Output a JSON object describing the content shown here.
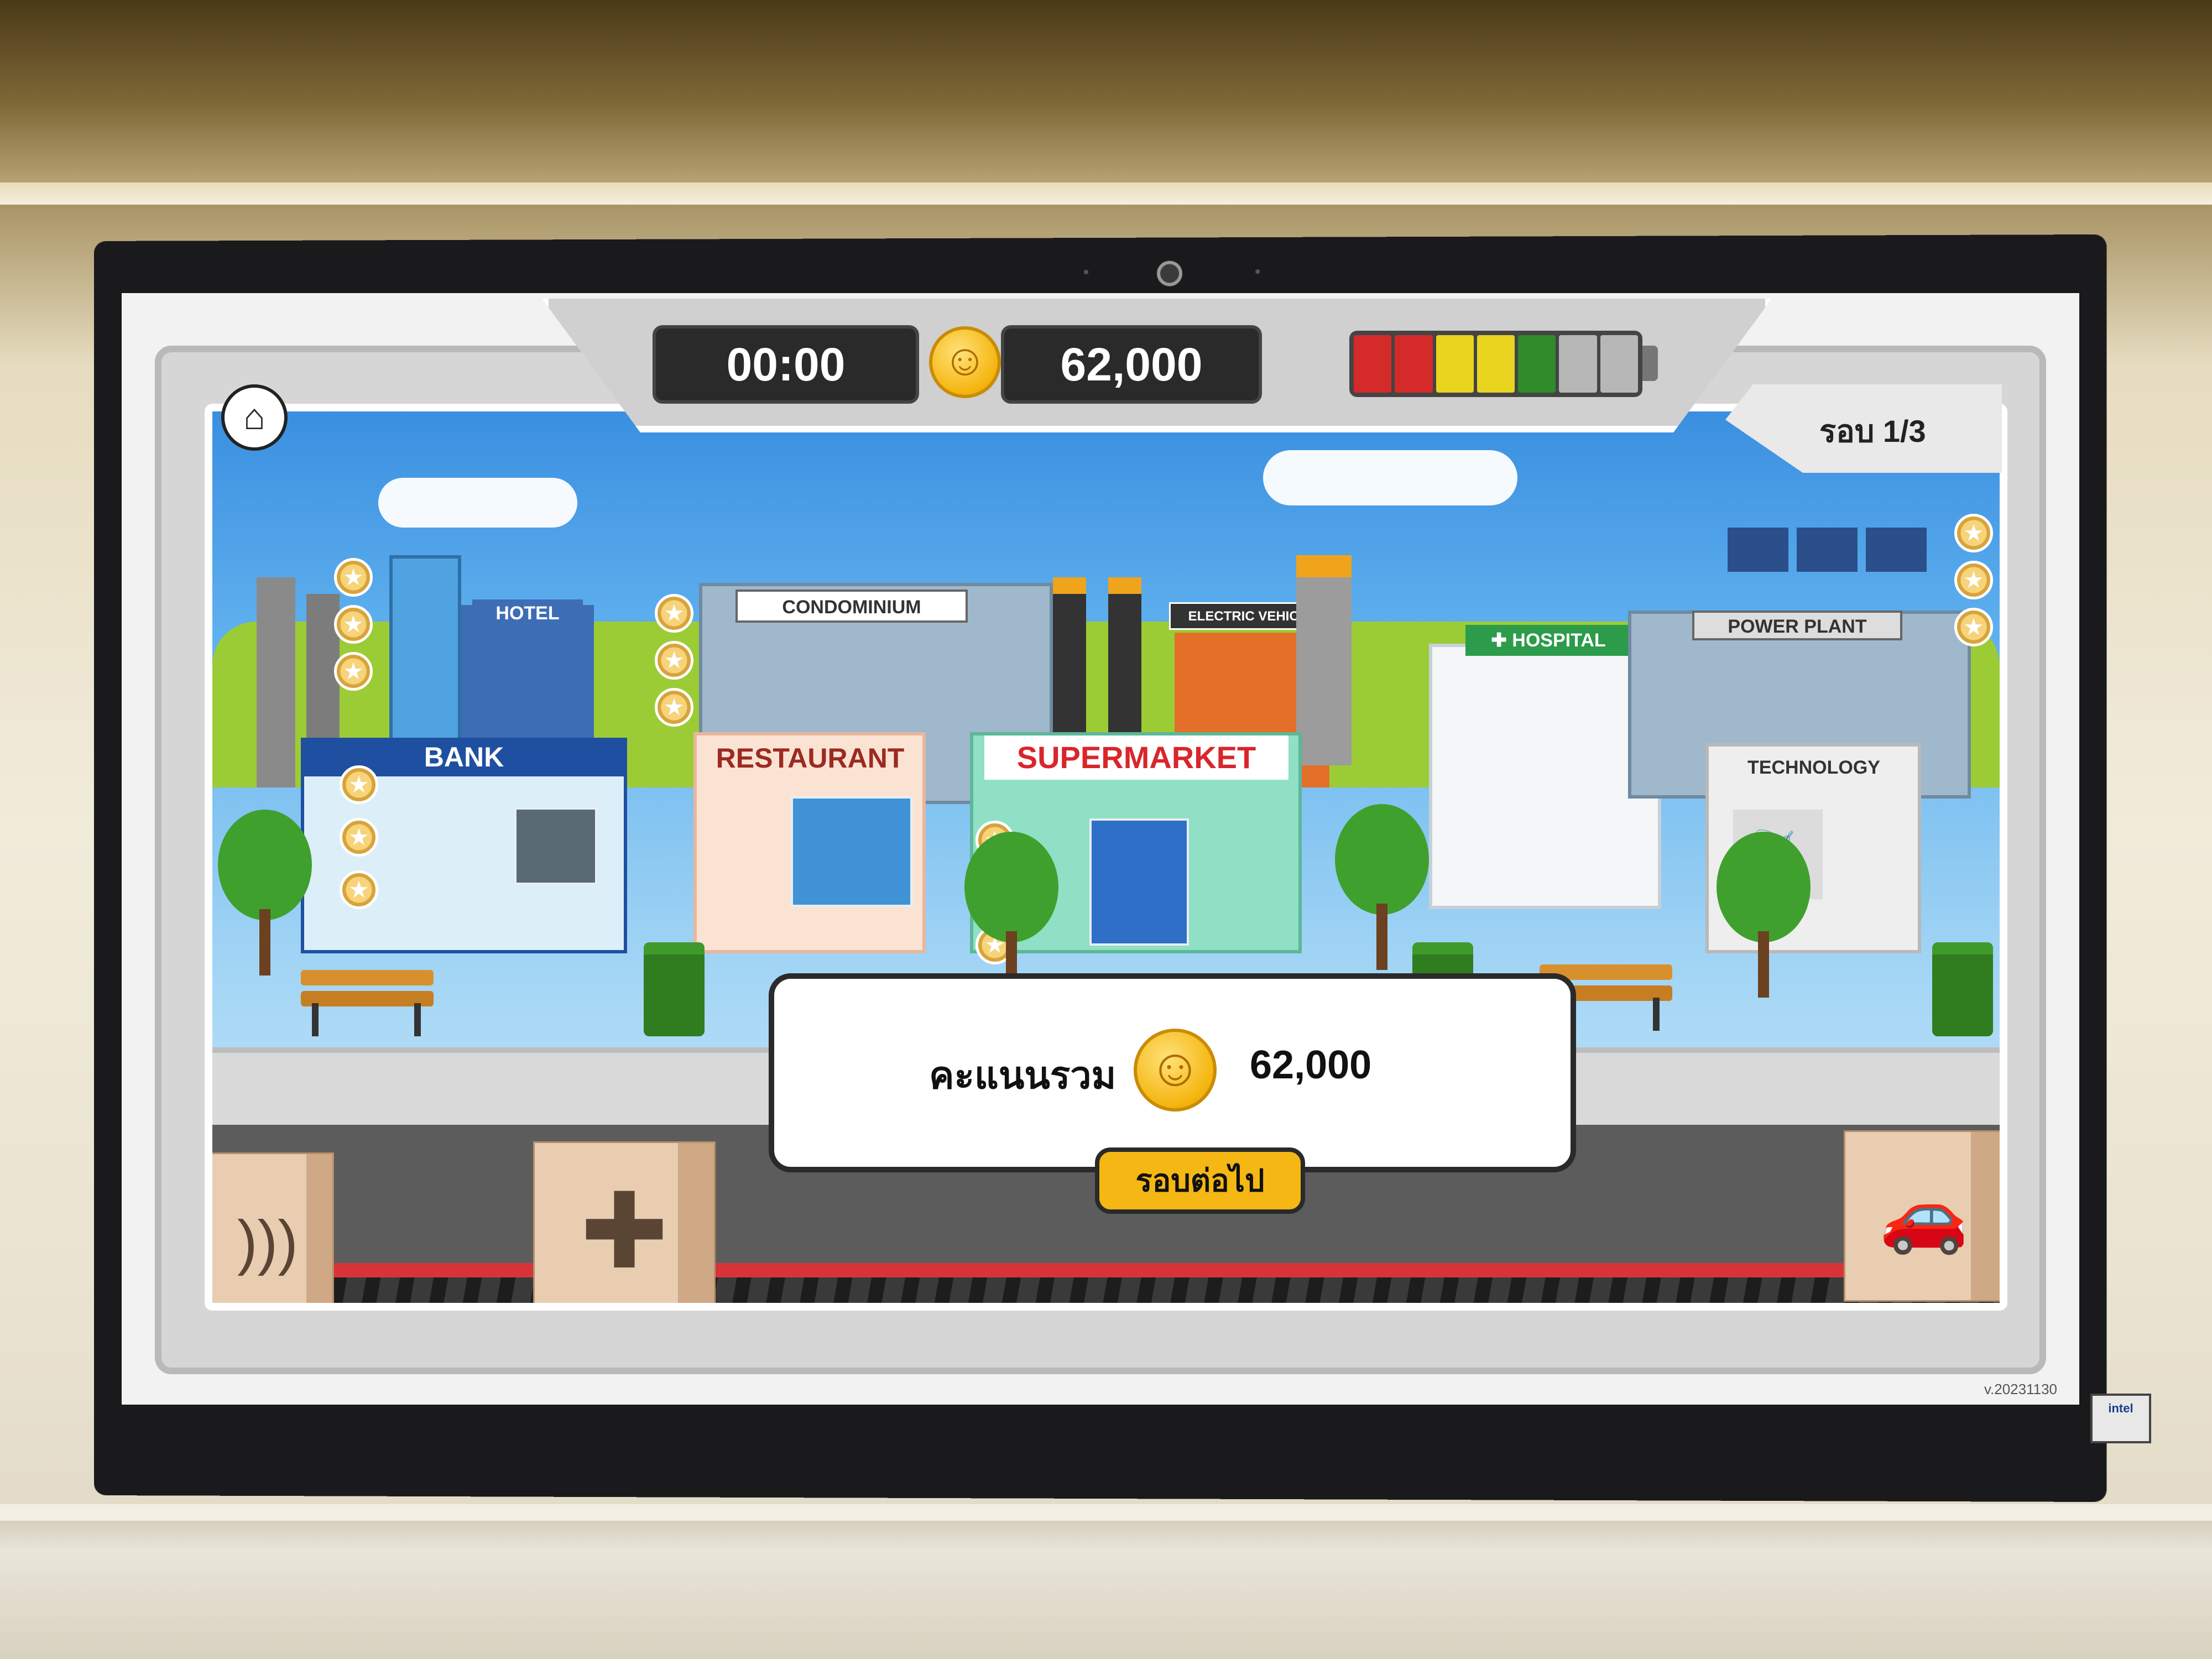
{
  "hud": {
    "timer": "00:00",
    "score": "62,000",
    "battery_cells": [
      "#d42a2a",
      "#d42a2a",
      "#e9d420",
      "#e9d420",
      "#2f8a2a",
      "#b7b7b7",
      "#b7b7b7"
    ],
    "round": "รอบ 1/3"
  },
  "scene": {
    "buildings": {
      "hotel": "HOTEL",
      "condominium": "CONDOMINIUM",
      "electric_vehicle": "ELECTRIC VEHICLE",
      "hospital": "HOSPITAL",
      "power_plant": "POWER PLANT",
      "bank": "BANK",
      "restaurant": "RESTAURANT",
      "supermarket": "SUPERMARKET",
      "technology": "TECHNOLOGY"
    }
  },
  "modal": {
    "total_label": "คะแนนรวม",
    "total_value": "62,000",
    "next_button": "รอบต่อไป"
  },
  "version": "v.20231130",
  "colors": {
    "accent_button": "#f5b713",
    "coin": "#f5b50f",
    "sign_supermarket": "#d8262b",
    "sign_bank": "#1f4fa0"
  },
  "icons": [
    "home-icon",
    "coin-smile-icon",
    "star-icon",
    "plus-icon",
    "car-icon",
    "wifi-icon"
  ]
}
